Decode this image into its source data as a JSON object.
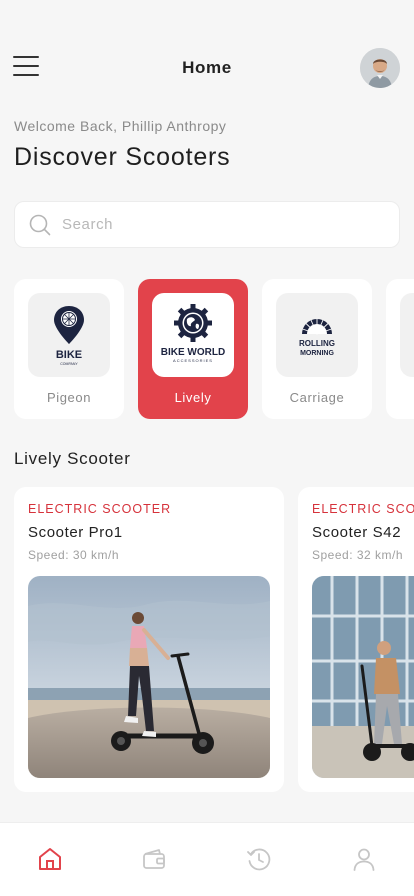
{
  "header": {
    "title": "Home"
  },
  "welcome": {
    "greeting": "Welcome Back, Phillip Anthropy",
    "heading": "Discover Scooters"
  },
  "search": {
    "placeholder": "Search",
    "value": ""
  },
  "brands": [
    {
      "label": "Pigeon",
      "logo_text": "BIKE",
      "logo_subtext": "COMPANY",
      "icon": "map-pin-wheel-icon",
      "active": false
    },
    {
      "label": "Lively",
      "logo_text": "BIKE WORLD",
      "logo_subtext": "ACCESSORIES",
      "icon": "gear-globe-icon",
      "active": true
    },
    {
      "label": "Carriage",
      "logo_text": "ROLLING",
      "logo_subtext": "MORNING",
      "icon": "wheel-arc-icon",
      "active": false
    }
  ],
  "section": {
    "title": "Lively Scooter"
  },
  "products": [
    {
      "category": "ELECTRIC SCOOTER",
      "name": "Scooter Pro1",
      "speed": "Speed: 30 km/h"
    },
    {
      "category": "ELECTRIC SCOOTER",
      "name": "Scooter S42",
      "speed": "Speed: 32 km/h"
    }
  ],
  "tabbar": [
    {
      "icon": "home-icon",
      "active": true
    },
    {
      "icon": "wallet-icon",
      "active": false
    },
    {
      "icon": "history-icon",
      "active": false
    },
    {
      "icon": "profile-icon",
      "active": false
    }
  ],
  "colors": {
    "accent": "#e2434b",
    "background": "#f6f6f6",
    "card": "#ffffff",
    "category_text": "#d6323b"
  }
}
